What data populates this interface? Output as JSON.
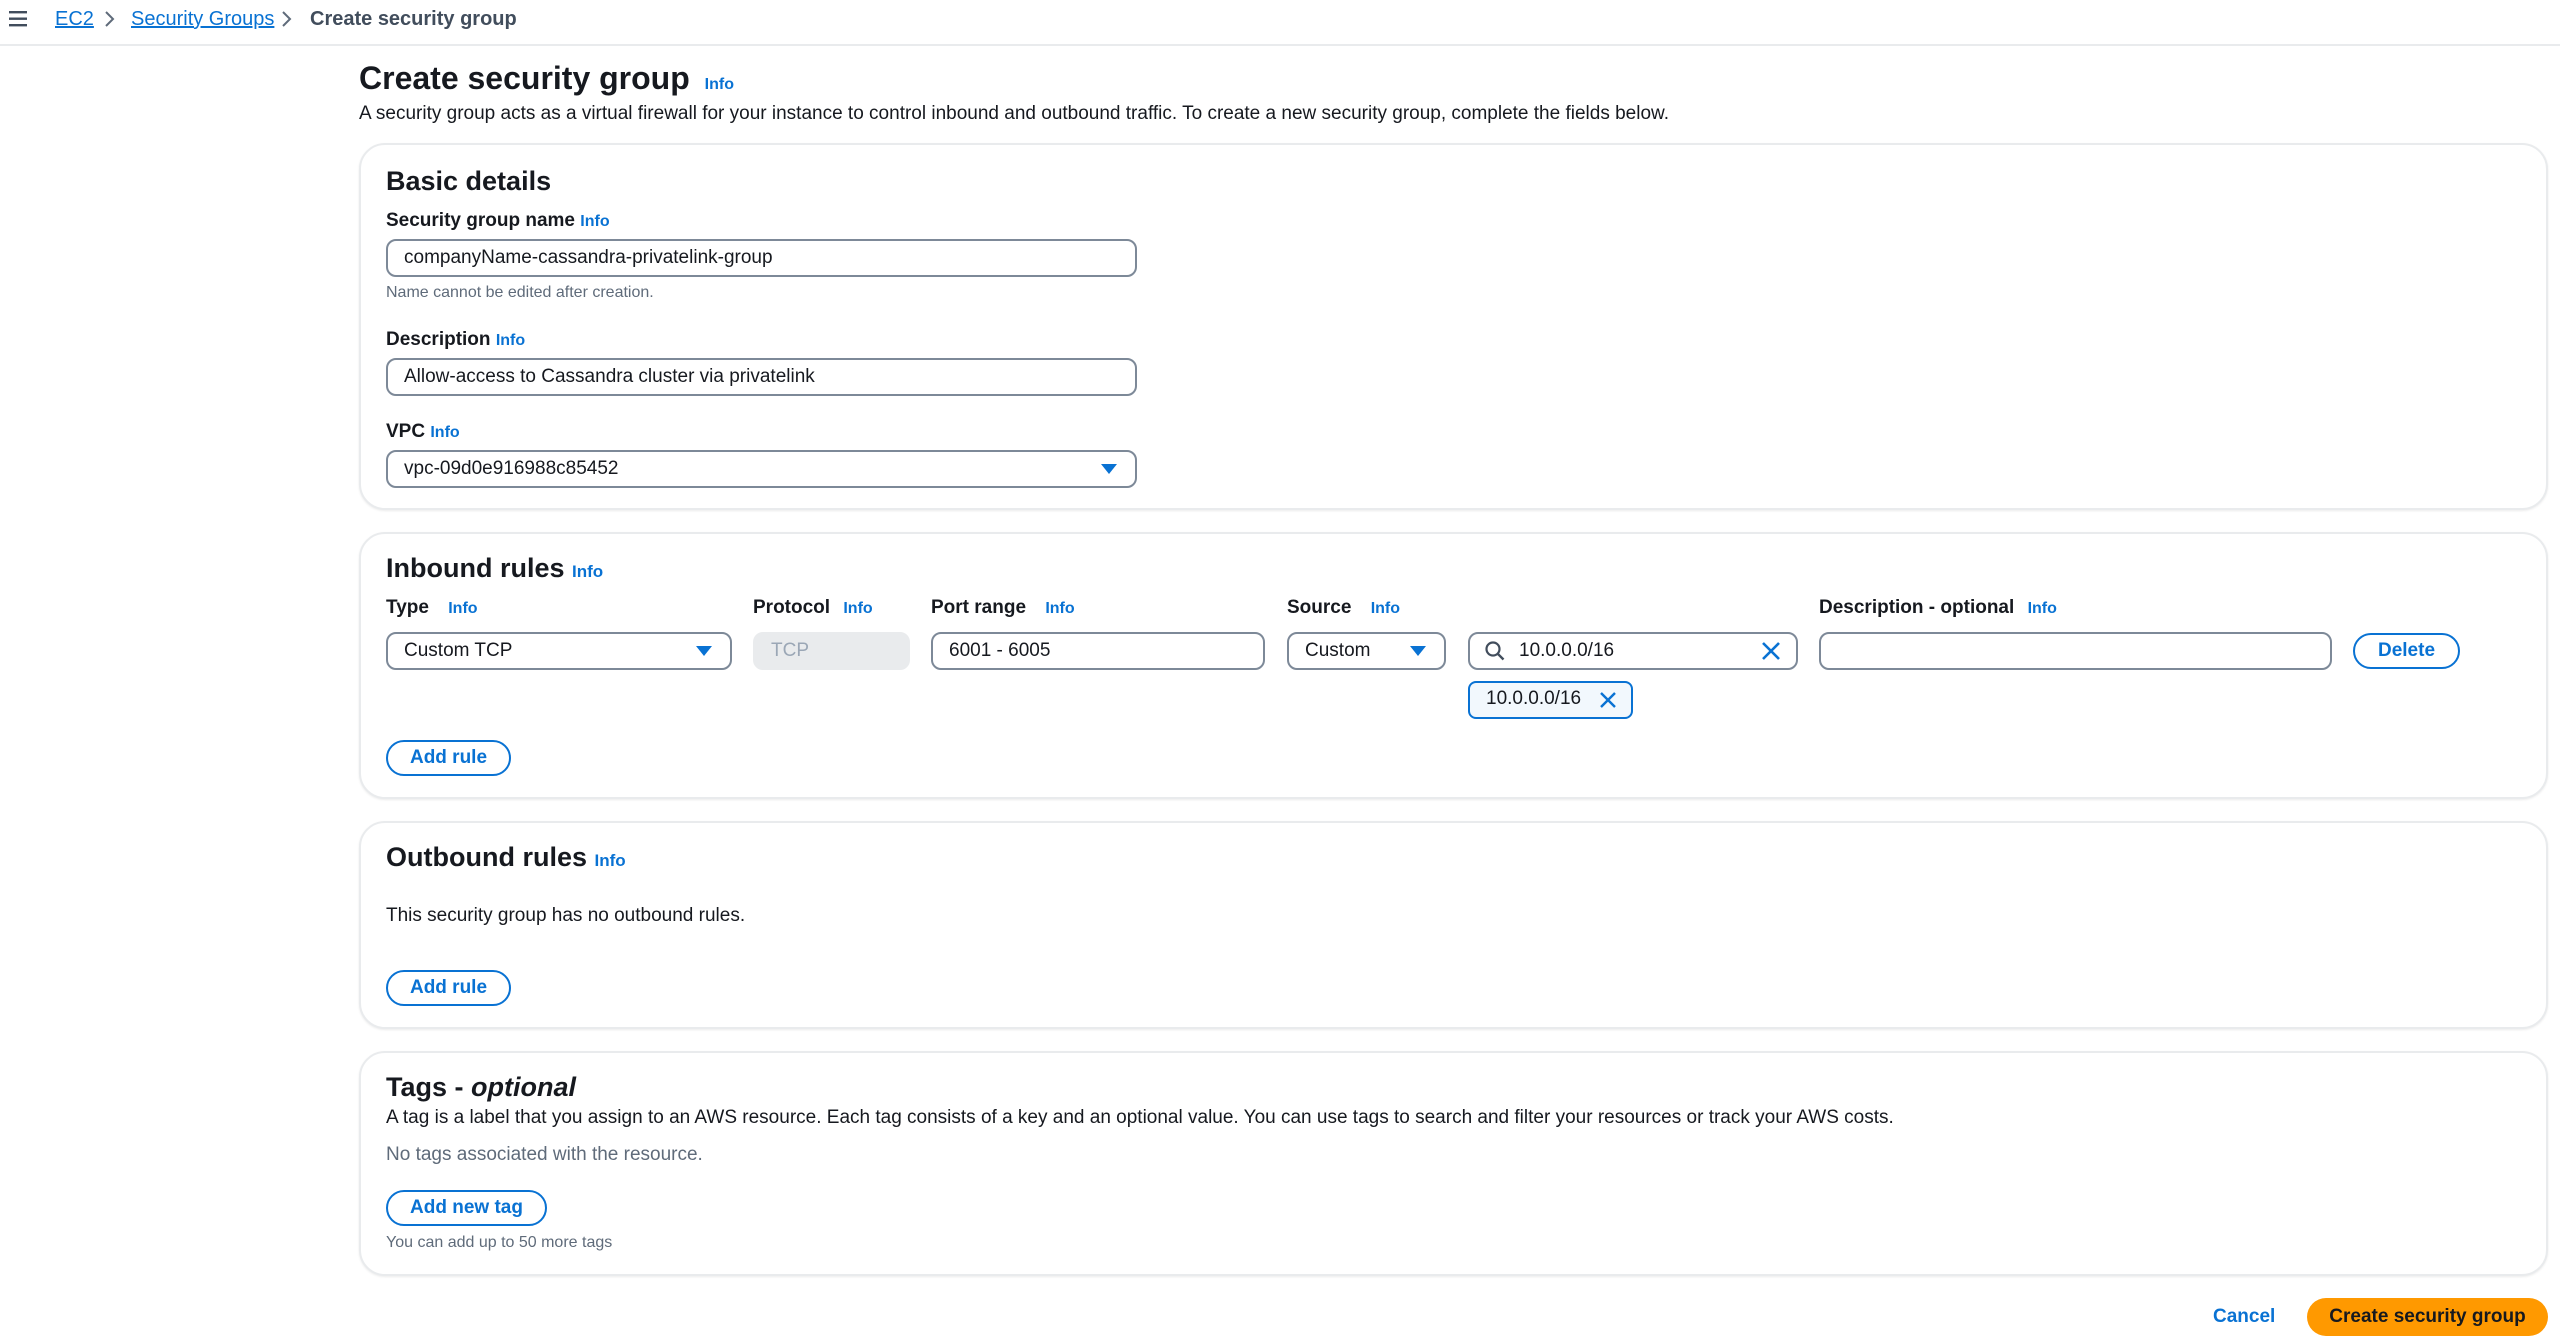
{
  "breadcrumb": {
    "items": [
      "EC2",
      "Security Groups"
    ],
    "current": "Create security group"
  },
  "header": {
    "title": "Create security group",
    "info": "Info",
    "description": "A security group acts as a virtual firewall for your instance to control inbound and outbound traffic. To create a new security group, complete the fields below."
  },
  "basic_details": {
    "heading": "Basic details",
    "name_label": "Security group name",
    "name_info": "Info",
    "name_value": "companyName-cassandra-privatelink-group",
    "name_hint": "Name cannot be edited after creation.",
    "description_label": "Description",
    "description_info": "Info",
    "description_value": "Allow-access to Cassandra cluster via privatelink",
    "vpc_label": "VPC",
    "vpc_info": "Info",
    "vpc_value": "vpc-09d0e916988c85452"
  },
  "inbound": {
    "heading": "Inbound rules",
    "info": "Info",
    "columns": {
      "type": "Type",
      "protocol": "Protocol",
      "port_range": "Port range",
      "source": "Source",
      "description": "Description - optional",
      "info": "Info"
    },
    "rule": {
      "type": "Custom TCP",
      "protocol": "TCP",
      "port_range": "6001 - 6005",
      "source": "Custom",
      "cidr_search": "10.0.0.0/16",
      "token": "10.0.0.0/16",
      "description": ""
    },
    "delete_label": "Delete",
    "add_rule_label": "Add rule"
  },
  "outbound": {
    "heading": "Outbound rules",
    "info": "Info",
    "empty_text": "This security group has no outbound rules.",
    "add_rule_label": "Add rule"
  },
  "tags": {
    "heading_main": "Tags - ",
    "heading_em": "optional",
    "description": "A tag is a label that you assign to an AWS resource. Each tag consists of a key and an optional value. You can use tags to search and filter your resources or track your AWS costs.",
    "empty_text": "No tags associated with the resource.",
    "add_tag_label": "Add new tag",
    "limit_hint": "You can add up to 50 more tags"
  },
  "footer": {
    "cancel_label": "Cancel",
    "create_label": "Create security group"
  },
  "colors": {
    "link": "#0972d3",
    "primary_button": "#ff9900",
    "border": "#e9ebed",
    "input_border": "#7d8998"
  }
}
